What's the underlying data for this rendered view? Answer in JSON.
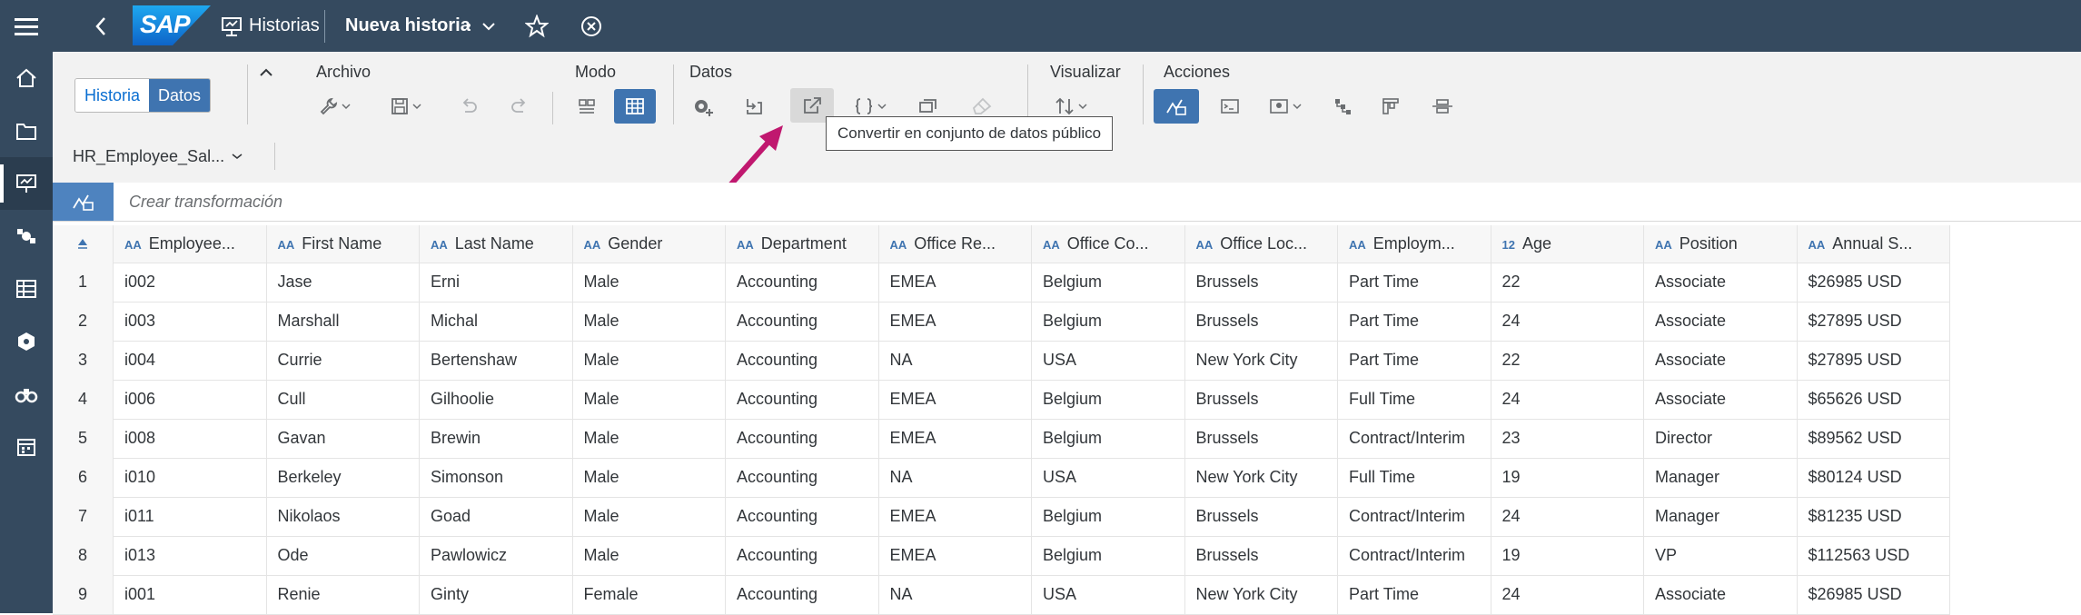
{
  "shellbar": {
    "logo_text": "SAP",
    "app_name": "Historias",
    "story_title": "Nueva historia",
    "unsaved_marker": "•"
  },
  "toolbar": {
    "view_toggle": {
      "historia": "Historia",
      "datos": "Datos"
    },
    "dataset_name": "HR_Employee_Sal...",
    "groups": {
      "archivo": "Archivo",
      "modo": "Modo",
      "datos": "Datos",
      "visualizar": "Visualizar",
      "acciones": "Acciones"
    },
    "tooltip": "Convertir en conjunto de datos público"
  },
  "transformation": {
    "placeholder": "Crear transformación"
  },
  "table": {
    "columns": [
      {
        "type": "AA",
        "label": "Employee..."
      },
      {
        "type": "AA",
        "label": "First Name"
      },
      {
        "type": "AA",
        "label": "Last Name"
      },
      {
        "type": "AA",
        "label": "Gender"
      },
      {
        "type": "AA",
        "label": "Department"
      },
      {
        "type": "AA",
        "label": "Office Re..."
      },
      {
        "type": "AA",
        "label": "Office Co..."
      },
      {
        "type": "AA",
        "label": "Office Loc..."
      },
      {
        "type": "AA",
        "label": "Employm..."
      },
      {
        "type": "12",
        "label": "Age"
      },
      {
        "type": "AA",
        "label": "Position"
      },
      {
        "type": "AA",
        "label": "Annual S..."
      }
    ],
    "rows": [
      {
        "n": "1",
        "c": [
          "i002",
          "Jase",
          "Erni",
          "Male",
          "Accounting",
          "EMEA",
          "Belgium",
          "Brussels",
          "Part Time",
          "22",
          "Associate",
          "$26985 USD"
        ]
      },
      {
        "n": "2",
        "c": [
          "i003",
          "Marshall",
          "Michal",
          "Male",
          "Accounting",
          "EMEA",
          "Belgium",
          "Brussels",
          "Part Time",
          "24",
          "Associate",
          "$27895 USD"
        ]
      },
      {
        "n": "3",
        "c": [
          "i004",
          "Currie",
          "Bertenshaw",
          "Male",
          "Accounting",
          "NA",
          "USA",
          "New York City",
          "Part Time",
          "22",
          "Associate",
          "$27895 USD"
        ]
      },
      {
        "n": "4",
        "c": [
          "i006",
          "Cull",
          "Gilhoolie",
          "Male",
          "Accounting",
          "EMEA",
          "Belgium",
          "Brussels",
          "Full Time",
          "24",
          "Associate",
          "$65626 USD"
        ]
      },
      {
        "n": "5",
        "c": [
          "i008",
          "Gavan",
          "Brewin",
          "Male",
          "Accounting",
          "EMEA",
          "Belgium",
          "Brussels",
          "Contract/Interim",
          "23",
          "Director",
          "$89562 USD"
        ]
      },
      {
        "n": "6",
        "c": [
          "i010",
          "Berkeley",
          "Simonson",
          "Male",
          "Accounting",
          "NA",
          "USA",
          "New York City",
          "Full Time",
          "19",
          "Manager",
          "$80124 USD"
        ]
      },
      {
        "n": "7",
        "c": [
          "i011",
          "Nikolaos",
          "Goad",
          "Male",
          "Accounting",
          "EMEA",
          "Belgium",
          "Brussels",
          "Contract/Interim",
          "24",
          "Manager",
          "$81235 USD"
        ]
      },
      {
        "n": "8",
        "c": [
          "i013",
          "Ode",
          "Pawlowicz",
          "Male",
          "Accounting",
          "EMEA",
          "Belgium",
          "Brussels",
          "Contract/Interim",
          "19",
          "VP",
          "$112563 USD"
        ]
      },
      {
        "n": "9",
        "c": [
          "i001",
          "Renie",
          "Ginty",
          "Female",
          "Accounting",
          "NA",
          "USA",
          "New York City",
          "Part Time",
          "24",
          "Associate",
          "$26985 USD"
        ]
      }
    ]
  },
  "colors": {
    "shell": "#354a5f",
    "accent": "#3f74b0",
    "annotation_arrow": "#c0186f"
  }
}
